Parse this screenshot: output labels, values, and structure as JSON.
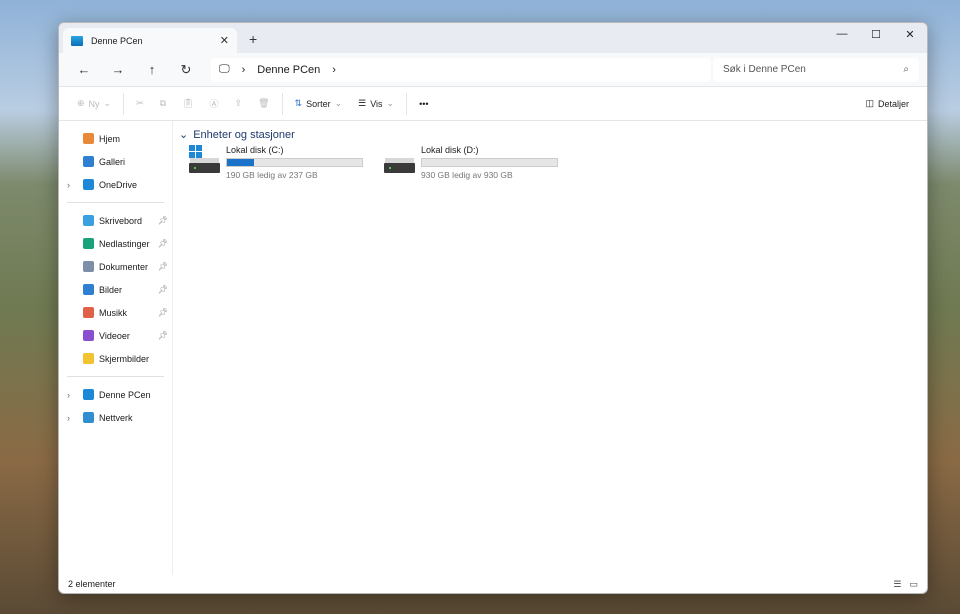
{
  "tab": {
    "title": "Denne PCen",
    "close": "✕",
    "new": "+"
  },
  "window_controls": {
    "minimize": "—",
    "maximize": "☐",
    "close": "✕"
  },
  "nav": {
    "back": "←",
    "forward": "→",
    "up": "↑",
    "refresh": "↻",
    "breadcrumb": "Denne PCen",
    "search_placeholder": "Søk i Denne PCen"
  },
  "toolbar": {
    "new": "Ny",
    "sort": "Sorter",
    "view": "Vis",
    "more": "•••",
    "details": "Detaljer"
  },
  "sidebar": {
    "top": [
      {
        "label": "Hjem",
        "color": "#e8893a"
      },
      {
        "label": "Galleri",
        "color": "#2f7fd0"
      },
      {
        "label": "OneDrive",
        "color": "#1e88d8",
        "expandable": true
      }
    ],
    "pinned": [
      {
        "label": "Skrivebord",
        "color": "#3aa0e0"
      },
      {
        "label": "Nedlastinger",
        "color": "#1aa37a"
      },
      {
        "label": "Dokumenter",
        "color": "#7d8ea8"
      },
      {
        "label": "Bilder",
        "color": "#2f7fd0"
      },
      {
        "label": "Musikk",
        "color": "#e0604a"
      },
      {
        "label": "Videoer",
        "color": "#8a4fd0"
      },
      {
        "label": "Skjermbilder",
        "color": "#f2c230"
      }
    ],
    "bottom": [
      {
        "label": "Denne PCen",
        "color": "#1e88d8"
      },
      {
        "label": "Nettverk",
        "color": "#2f8fd0"
      }
    ]
  },
  "main": {
    "group": "Enheter og stasjoner",
    "drives": [
      {
        "name": "Lokal disk (C:)",
        "size": "190 GB ledig av 237 GB",
        "used_fraction": 0.2,
        "system": true
      },
      {
        "name": "Lokal disk (D:)",
        "size": "930 GB ledig av 930 GB",
        "used_fraction": 0,
        "system": false
      }
    ]
  },
  "status": {
    "count": "2 elementer"
  }
}
